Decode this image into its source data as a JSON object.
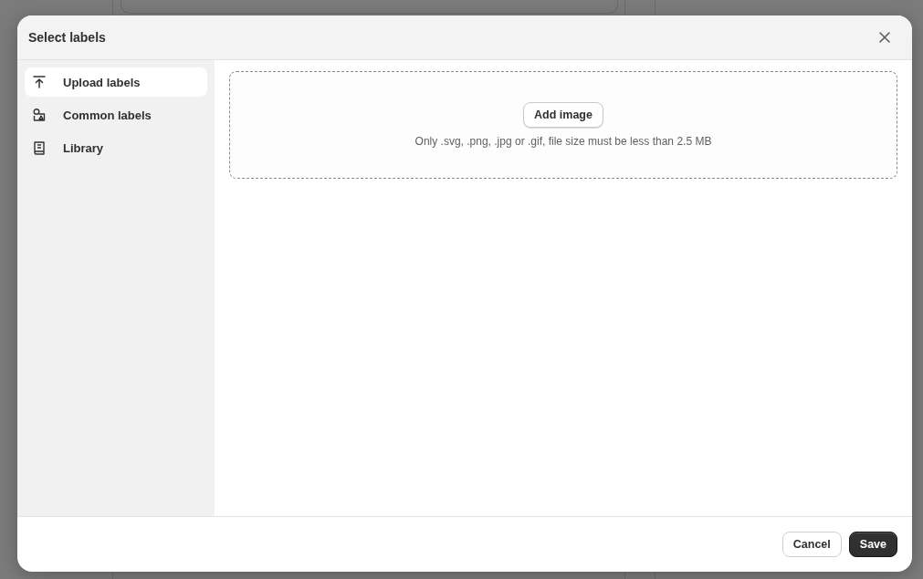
{
  "dialog": {
    "title": "Select labels",
    "sidebar": {
      "items": [
        {
          "label": "Upload labels",
          "kind": "upload",
          "selected": true
        },
        {
          "label": "Common labels",
          "kind": "shapes",
          "selected": false
        },
        {
          "label": "Library",
          "kind": "book",
          "selected": false
        }
      ]
    },
    "upload": {
      "button": "Add image",
      "hint": "Only .svg, .png, .jpg or .gif, file size must be less than 2.5 MB"
    },
    "footer": {
      "buttons": [
        {
          "label": "Cancel",
          "kind": "secondary"
        },
        {
          "label": "Save",
          "kind": "primary"
        }
      ]
    }
  }
}
